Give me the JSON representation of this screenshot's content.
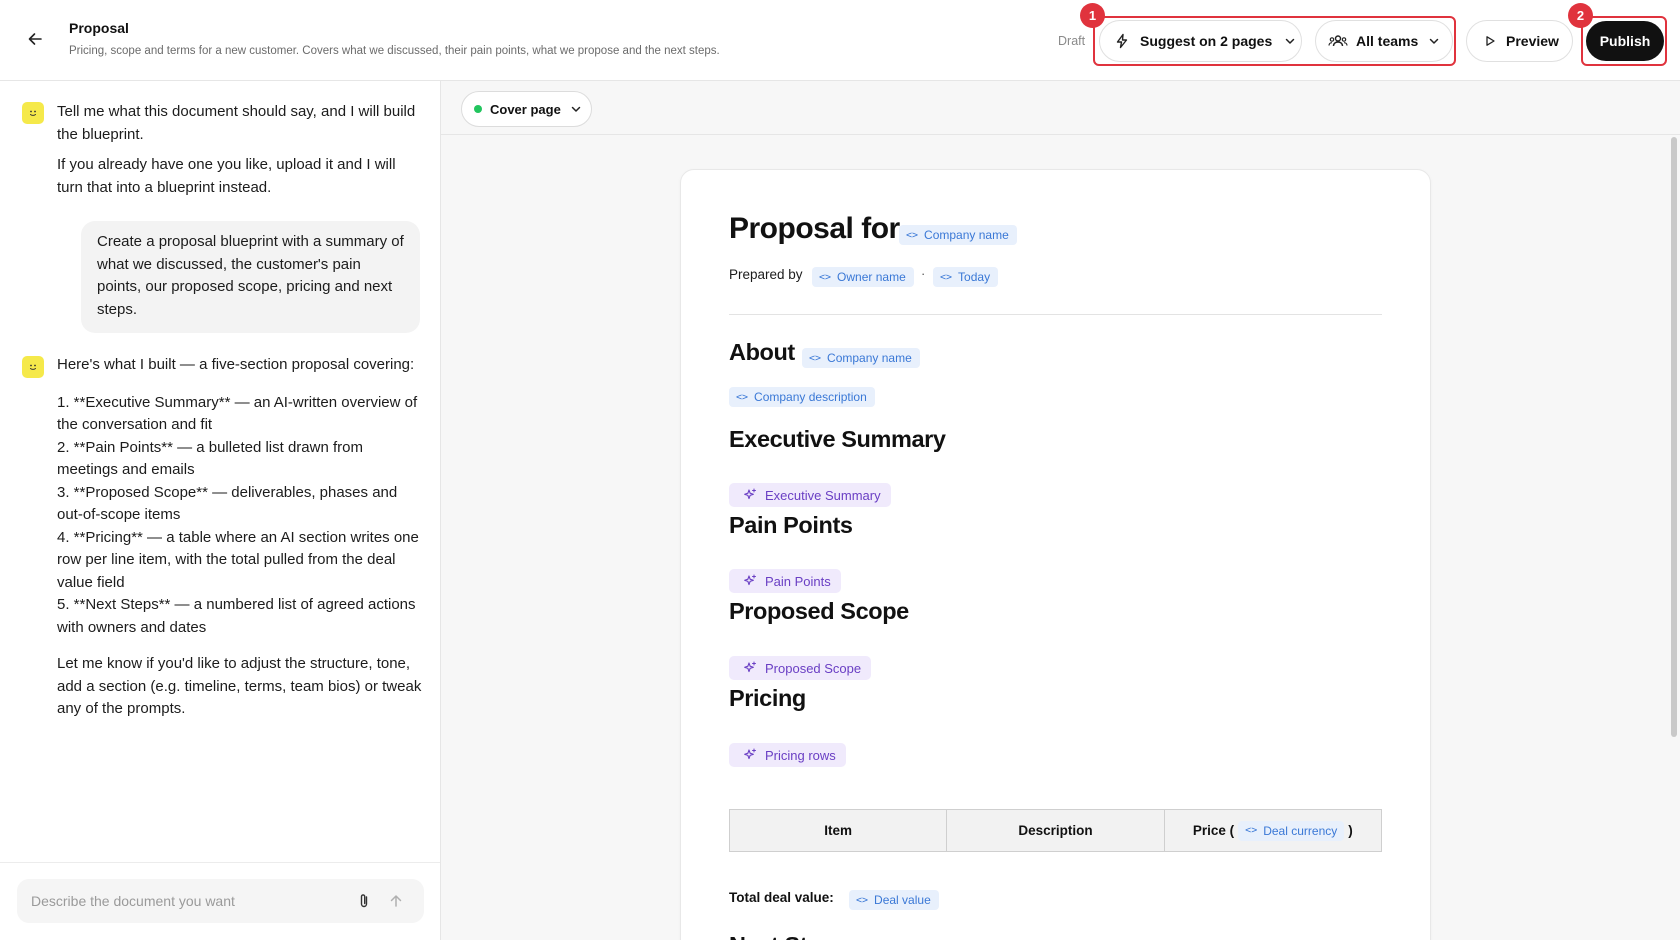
{
  "header": {
    "title": "Proposal",
    "subtitle": "Pricing, scope and terms for a new customer. Covers what we discussed, their pain points, what we propose and the next steps.",
    "status": "Draft",
    "suggest_label": "Suggest on 2 pages",
    "teams_label": "All teams",
    "preview_label": "Preview",
    "publish_label": "Publish",
    "annotations": [
      "1",
      "2"
    ]
  },
  "chat": {
    "messages": {
      "bot_intro_1": "Tell me what this document should say, and I will build the blueprint.",
      "bot_intro_2": "If you already have one you like, upload it and I will turn that into a blueprint instead.",
      "user_request": "Create a proposal blueprint with a summary of what we discussed, the customer's pain points, our proposed scope, pricing and next steps.",
      "bot_reply_intro": "Here's what I built — a five-section proposal covering:",
      "bot_reply_items": [
        "1. **Executive Summary** — an AI-written overview of the conversation and fit",
        "2. **Pain Points** — a bulleted list drawn from meetings and emails",
        "3. **Proposed Scope** — deliverables, phases and out-of-scope items",
        "4. **Pricing** — a table where an AI section writes one row per line item, with the total pulled from the deal value field",
        "5. **Next Steps** — a numbered list of agreed actions with owners and dates"
      ],
      "bot_reply_outro": "Let me know if you'd like to adjust the structure, tone, add a section (e.g. timeline, terms, team bios) or tweak any of the prompts."
    },
    "input": {
      "placeholder": "Describe the document you want",
      "value": ""
    }
  },
  "preview": {
    "page_selector": "Cover page",
    "document": {
      "title_prefix": "Proposal for",
      "title_var": "Company name",
      "prepared_by_label": "Prepared by",
      "owner_var": "Owner name",
      "separator": "·",
      "date_var": "Today",
      "about_heading": "About",
      "about_var": "Company name",
      "description_var": "Company description",
      "sections": [
        {
          "heading": "Executive Summary",
          "ai_block": "Executive Summary"
        },
        {
          "heading": "Pain Points",
          "ai_block": "Pain Points"
        },
        {
          "heading": "Proposed Scope",
          "ai_block": "Proposed Scope"
        },
        {
          "heading": "Pricing",
          "ai_block": "Pricing rows"
        }
      ],
      "table_headers": [
        "Item",
        "Description",
        "Price ("
      ],
      "price_close": ")",
      "currency_var": "Deal currency",
      "total_label": "Total deal value:",
      "total_var": "Deal value",
      "next_heading": "Next Steps"
    }
  },
  "icons": {
    "back": "arrow-left-icon",
    "suggest": "lightning-icon",
    "teams": "users-icon",
    "preview": "play-icon",
    "chevron": "chevron-down-icon",
    "bot": "smiley-icon",
    "attach": "paperclip-icon",
    "send": "arrow-up-icon",
    "variable": "code-braces-icon",
    "ai": "sparkles-icon"
  },
  "colors": {
    "annotation": "#e0333d",
    "publish_bg": "#111111",
    "variable_chip_bg": "#e8f0fc",
    "variable_chip_text": "#3a78d6",
    "ai_chip_bg": "#f0eafc",
    "ai_chip_text": "#6a3fc4",
    "bot_avatar": "#f5e94a",
    "status_dot": "#22c55e"
  }
}
